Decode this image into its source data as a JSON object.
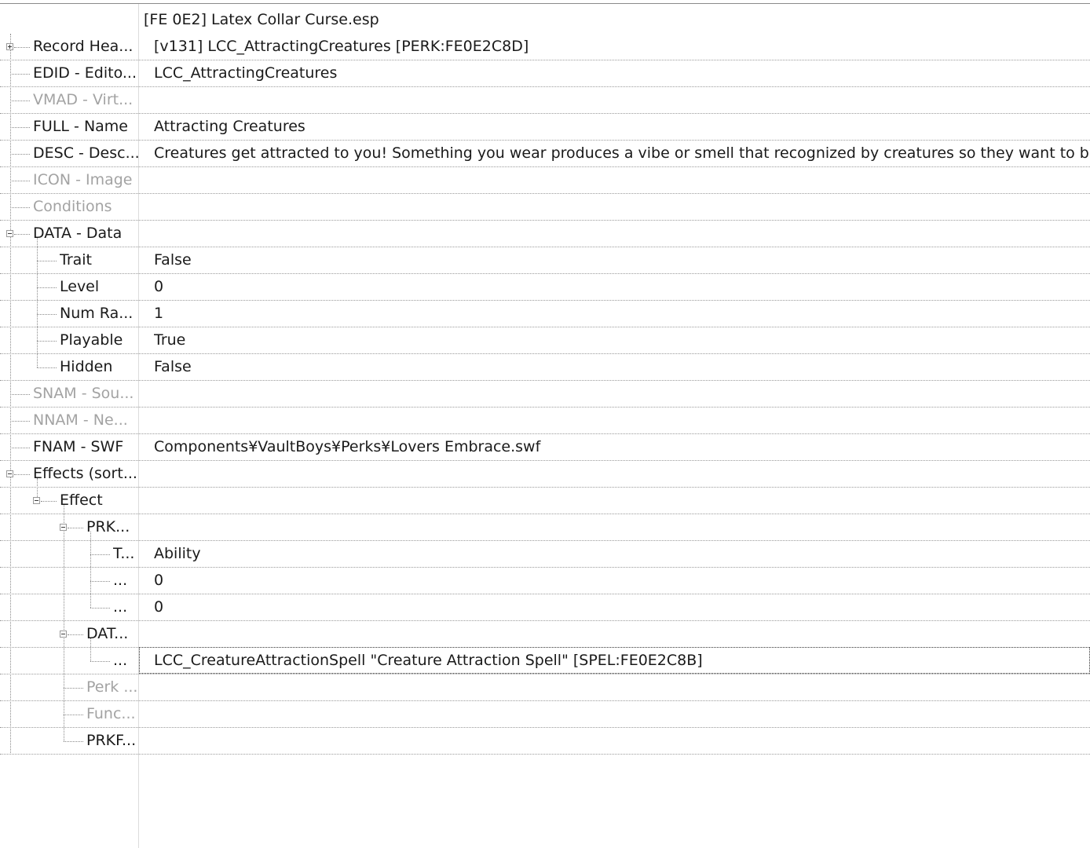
{
  "header": {
    "file_title": "[FE 0E2] Latex Collar Curse.esp"
  },
  "rows": [
    {
      "name": "Record Hea...",
      "value": "[v131] LCC_AttractingCreatures [PERK:FE0E2C8D]"
    },
    {
      "name": "EDID - Edito...",
      "value": "LCC_AttractingCreatures"
    },
    {
      "name": "VMAD - Virt...",
      "value": ""
    },
    {
      "name": "FULL - Name",
      "value": "Attracting Creatures"
    },
    {
      "name": "DESC - Desc...",
      "value": "Creatures get attracted to you! Something you wear produces a vibe or smell that recognized by creatures so they want to breed you. Yo"
    },
    {
      "name": "ICON - Image",
      "value": ""
    },
    {
      "name": "Conditions",
      "value": ""
    },
    {
      "name": "DATA - Data",
      "value": ""
    },
    {
      "name": "Trait",
      "value": "False"
    },
    {
      "name": "Level",
      "value": "0"
    },
    {
      "name": "Num Ra...",
      "value": "1"
    },
    {
      "name": "Playable",
      "value": "True"
    },
    {
      "name": "Hidden",
      "value": "False"
    },
    {
      "name": "SNAM - Sou...",
      "value": ""
    },
    {
      "name": "NNAM - Ne...",
      "value": ""
    },
    {
      "name": "FNAM - SWF",
      "value": "Components¥VaultBoys¥Perks¥Lovers Embrace.swf"
    },
    {
      "name": "Effects (sort...",
      "value": ""
    },
    {
      "name": "Effect",
      "value": ""
    },
    {
      "name": "PRK...",
      "value": ""
    },
    {
      "name": "T...",
      "value": "Ability"
    },
    {
      "name": "...",
      "value": "0"
    },
    {
      "name": "...",
      "value": "0"
    },
    {
      "name": "DAT...",
      "value": ""
    },
    {
      "name": "...",
      "value": "LCC_CreatureAttractionSpell \"Creature Attraction Spell\" [SPEL:FE0E2C8B]"
    },
    {
      "name": "Perk ...",
      "value": ""
    },
    {
      "name": "Func...",
      "value": ""
    },
    {
      "name": "PRKF...",
      "value": ""
    }
  ]
}
